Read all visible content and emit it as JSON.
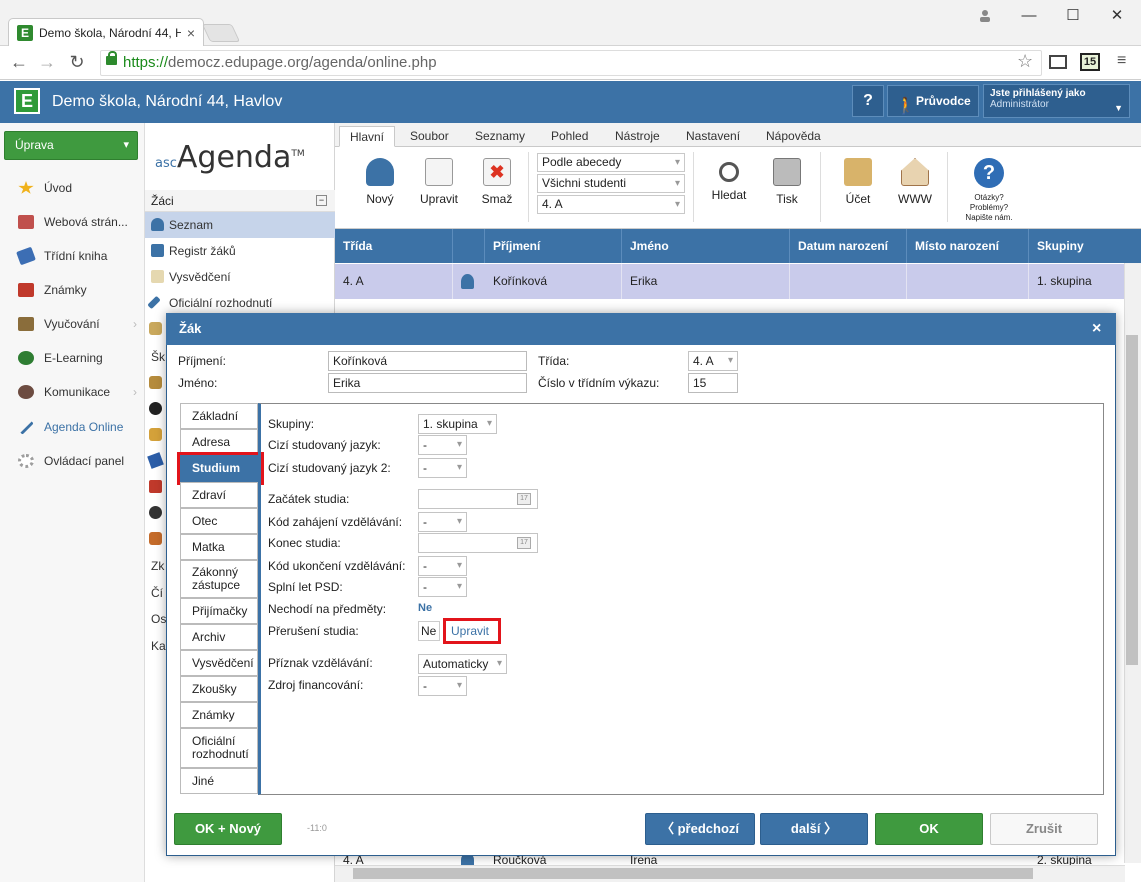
{
  "browser": {
    "tab_title": "Demo škola, Národní 44, H",
    "tab_close": "×",
    "url_https": "https://",
    "url_rest": "democz.edupage.org/agenda/online.php",
    "window_min": "—",
    "window_max": "☐",
    "window_close": "✕",
    "ext_badge": "15"
  },
  "header": {
    "logo": "E",
    "school_name": "Demo škola, Národní 44, Havlov",
    "help_label": "?",
    "guide_label": "Průvodce",
    "login_label": "Jste přihlášený jako",
    "login_user": "Administrátor"
  },
  "sidebar": {
    "action_label": "Úprava",
    "items": [
      {
        "label": "Úvod",
        "icon": "star-icon",
        "color": "#f0b21c"
      },
      {
        "label": "Webová strán...",
        "icon": "web-icon",
        "color": "#c0504d"
      },
      {
        "label": "Třídní kniha",
        "icon": "book-icon",
        "color": "#3c6eb4"
      },
      {
        "label": "Známky",
        "icon": "grades-icon",
        "color": "#c0392b"
      },
      {
        "label": "Vyučování",
        "icon": "teaching-icon",
        "color": "#8a6d3b"
      },
      {
        "label": "E-Learning",
        "icon": "elearning-icon",
        "color": "#2e7d32"
      },
      {
        "label": "Komunikace",
        "icon": "communication-icon",
        "color": "#6d4c41"
      },
      {
        "label": "Agenda Online",
        "icon": "pen-icon",
        "color": "#3c72a6"
      },
      {
        "label": "Ovládací panel",
        "icon": "gear-icon",
        "color": "#9e9e9e"
      }
    ]
  },
  "agenda_panel": {
    "logo_prefix": "asc",
    "logo_main": "Agenda",
    "logo_tm": "TM",
    "section_title": "Žáci",
    "collapse": "−",
    "items": [
      {
        "label": "Seznam"
      },
      {
        "label": "Registr žáků"
      },
      {
        "label": "Vysvědčení"
      },
      {
        "label": "Oficiální rozhodnutí"
      }
    ],
    "truncated": [
      "Šk",
      "Zk",
      "Čí",
      "Os",
      "Ka"
    ]
  },
  "ribbon": {
    "tabs": [
      "Hlavní",
      "Soubor",
      "Seznamy",
      "Pohled",
      "Nástroje",
      "Nastavení",
      "Nápověda"
    ],
    "buttons": {
      "new": "Nový",
      "edit": "Upravit",
      "delete": "Smaž",
      "search": "Hledat",
      "print": "Tisk",
      "account": "Účet",
      "www": "WWW"
    },
    "selects": [
      "Podle abecedy",
      "Všichni studenti",
      "4. A"
    ],
    "help_text": "Otázky? Problémy? Napište nám."
  },
  "grid": {
    "columns": [
      "Třída",
      "",
      "Příjmení",
      "Jméno",
      "Datum narození",
      "Místo narození",
      "Skupiny"
    ],
    "rows": [
      [
        "4. A",
        "",
        "Kořínková",
        "Erika",
        "",
        "",
        "1. skupina"
      ],
      [
        "4. A",
        "",
        "Roučková",
        "Irena",
        "",
        "",
        "2. skupina"
      ]
    ]
  },
  "dialog": {
    "title": "Žák",
    "close": "×",
    "fields": {
      "surname_label": "Příjmení:",
      "surname_value": "Kořínková",
      "name_label": "Jméno:",
      "name_value": "Erika",
      "class_label": "Třída:",
      "class_value": "4. A",
      "register_label": "Číslo v třídním výkazu:",
      "register_value": "15"
    },
    "tabs": [
      "Základní",
      "Adresa",
      "Studium",
      "Zdraví",
      "Otec",
      "Matka",
      "Zákonný zástupce",
      "Přijímačky",
      "Archiv",
      "Vysvědčení",
      "Zkoušky",
      "Známky",
      "Oficiální rozhodnutí",
      "Jiné"
    ],
    "active_tab": "Studium",
    "study": {
      "groups_label": "Skupiny:",
      "groups_value": "1. skupina",
      "foreign_lang_label": "Cizí studovaný jazyk:",
      "foreign_lang_value": "-",
      "foreign_lang2_label": "Cizí studovaný jazyk 2:",
      "foreign_lang2_value": "-",
      "start_label": "Začátek studia:",
      "start_code_label": "Kód zahájení vzdělávání:",
      "start_code_value": "-",
      "end_label": "Konec studia:",
      "end_code_label": "Kód ukončení vzdělávání:",
      "end_code_value": "-",
      "psd_label": "Splní let PSD:",
      "psd_value": "-",
      "not_attending_label": "Nechodí na předměty:",
      "not_attending_value": "Ne",
      "interrupt_label": "Přerušení studia:",
      "interrupt_value": "Ne",
      "interrupt_edit": "Upravit",
      "education_flag_label": "Příznak vzdělávání:",
      "education_flag_value": "Automaticky",
      "funding_label": "Zdroj financování:",
      "funding_value": "-",
      "calendar_day": "17"
    },
    "footer": {
      "ok_new": "OK + Nový",
      "version": "-11:0",
      "prev": "předchozí",
      "next": "další",
      "ok": "OK",
      "cancel": "Zrušit"
    }
  }
}
